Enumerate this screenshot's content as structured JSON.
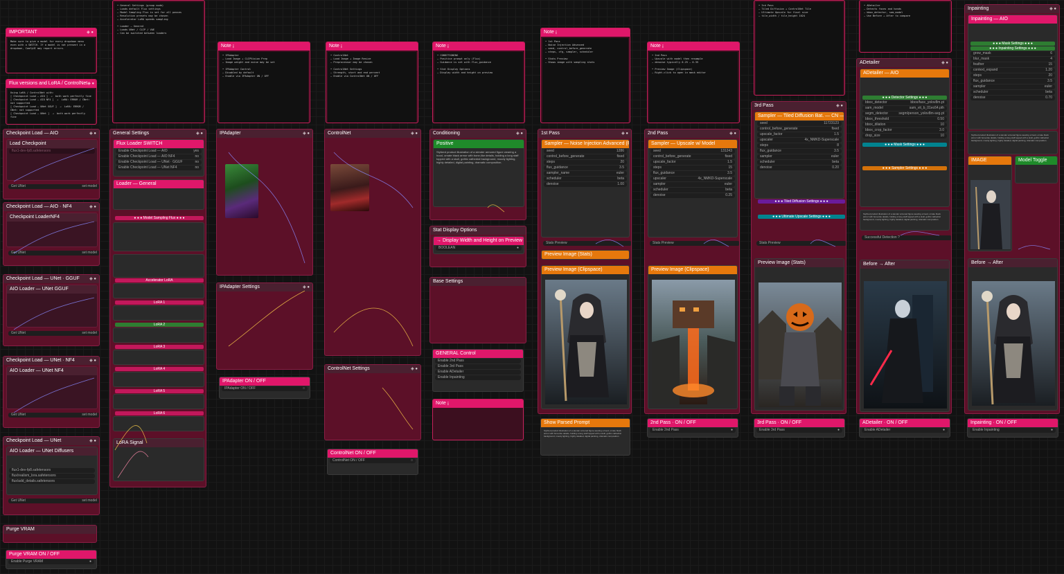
{
  "groups": {
    "ckpt_aio": "Checkpoint Load — AIO",
    "ckpt_aio_nf4": "Checkpoint Load — AIO · NF4",
    "ckpt_unet_gguf": "Checkpoint Load — UNet · GGUF",
    "ckpt_unet_nf4": "Checkpoint Load — UNet · NF4",
    "ckpt_unet": "Checkpoint Load — UNet",
    "purge_vram": "Purge VRAM",
    "general": "General Settings",
    "ipadapter": "IPAdapter",
    "ipadapter_settings": "IPAdapter Settings",
    "controlnet": "ControlNet",
    "controlnet_settings": "ControlNet Settings",
    "conditioning": "Conditioning",
    "stat_display": "Stat Display Options",
    "base_settings": "Base Settings",
    "first_pass": "1st Pass",
    "second_pass": "2nd Pass",
    "third_pass": "3rd Pass",
    "adetailer": "ADetailer",
    "inpainting": "Inpainting"
  },
  "nodes": {
    "important": "IMPORTANT",
    "flux_versions": "Flux versions and LoRA / ControlNet",
    "load_checkpoint": "Load Checkpoint",
    "checkpoint_loader_nf4": "Checkpoint LoaderNF4",
    "aio_loader_unet_gguf": "AIO Loader — UNet GGUF",
    "aio_loader_unet_nf4": "AIO Loader — UNet NF4",
    "aio_loader_unet_diffusers": "AIO Loader — UNet Diffusers",
    "flux_loader_switch": "Flux Loader SWITCH",
    "loader_general": "Loader — General",
    "lora_signal": "LoRA Signal",
    "ipadapter_onoff": "IPAdapter ON / OFF",
    "controlnet_onoff": "ControlNet ON / OFF",
    "positive": "Positive",
    "display_wh": "→ Display Width and Height on Preview ? ←",
    "general_control": "GENERAL Control",
    "sampler_1st": "Sampler — Noise Injection Advanced (Flux)",
    "sampler_2nd": "Sampler — Upscale w/ Model",
    "sampler_3rd": "Sampler — Tiled Diffusion Bat. — CN — Ultimate Upscale",
    "adetailer_aio": "ADetailer — AIO",
    "inpainting_aio": "Inpainting — AIO",
    "preview_stats": "Preview Image (Stats)",
    "preview_clip": "Preview Image (Clipspace)",
    "show_parsed_prompt": "Show Parsed Prompt",
    "pass2_onoff": "2nd Pass · ON / OFF",
    "pass3_onoff": "3rd Pass · ON / OFF",
    "adetailer_onoff": "ADetailer · ON / OFF",
    "inpainting_onoff": "Inpainting · ON / OFF",
    "purge_onoff": "Purge VRAM ON / OFF",
    "before_after": "Before → After",
    "successful_detection": "Successful Detection ?",
    "note": "Note ¡"
  },
  "labels": {
    "opt_connection": "OPT_CONNECTION",
    "model_sampling": "● ● ● Model Sampling Flux ● ● ●",
    "accelerator_lora": "Accelerator LoRA",
    "lora_1": "LoRA 1",
    "lora_2": "LoRA 2",
    "lora_3": "LoRA 3",
    "lora_4": "LoRA 4",
    "lora_5": "LoRA 5",
    "lora_6": "LoRA 6",
    "get_unet": "Get UNet",
    "set_model": "set model",
    "enable_2nd": "Enable 2nd Pass",
    "enable_3rd": "Enable 3rd Pass",
    "enable_adetailer": "Enable ADetailer",
    "enable_inpainting": "Enable Inpainting",
    "enable_purge": "Enable Purge VRAM",
    "boolean": "BOOLEAN",
    "image": "IMAGE",
    "stats_preview": "Stats Preview",
    "mask_settings": "● ● ● Mask Settings ● ● ●",
    "inpainting_settings": "● ● ● Inpainting Settings ● ● ●",
    "sampler_settings": "● ● ● Sampler Settings ● ● ●",
    "detector_settings": "● ● ● Detector Settings ● ● ●",
    "tiled_diffusion_settings": "● ● ● Tiled Diffusion Settings ● ● ●",
    "ultimate_upscale_settings": "● ● ● Ultimate Upscale Settings ● ● ●",
    "model_toggle": "Model Toggle",
    "loras_list": [
      "flux1-dev-fp8.safetensors",
      "flux/realism_lora.safetensors",
      "flux/add_details.safetensors"
    ]
  },
  "flux_versions_text": "Using LoRA / ControlNet with:\n[ Checkpoint Load — AIO ]  →  both work perfectly fine\n[ Checkpoint Load — AIO NF4 ]  →  LoRA: ERROR / CNet: not supported\n[ Checkpoint Load — UNet GGUF ]  →  LoRA: ERROR / CNet: not supported\n[ Checkpoint Load — UNet ]  →  both work perfectly fine",
  "important_text": "Make sure to give a model for every dropdown menu\neven with a SWITCH. If a model is not present in a\ndropdown, ComfyUI may report errors.",
  "prompt_text": "Stylized product illustration of a slender armored figure wearing a hood, ornate black armor with bone-like details, holding a long staff topped with a skull, gothic cathedral background, moody lighting, highly detailed, digital painting, dramatic composition.",
  "notes_text": [
    "• General Settings (group node)\n— Loads default Flux settings\n— Model Sampling Flux is set for all passes\n— Resolution presets may be chosen\n— Accelerator LoRA speeds sampling\n\n• Loader — General\n— Loads UNet / CLIP / VAE\n— Can be switched between loaders",
    "• IPAdapter\n— Load Image + CLIPVision Prep\n— Image weight and noise may be set\n\n• IPAdapter Control\n— Disabled by default\n— Enable via IPAdapter ON / OFF",
    "• ControlNet\n— Load Image + Image Resize\n— Preprocessor may be chosen\n\n• ControlNet Settings\n— Strength, start and end percent\n— Enable via ControlNet ON / OFF",
    "• CONDITIONING\n— Positive prompt only (Flux)\n— Guidance is set with flux_guidance\n\n• Stat Display Options\n— Display width and height on preview",
    "• 1st Pass\n— Noise Injection Advanced\n— seed, control_before_generate\n— steps, cfg, sampler, scheduler\n\n• Stats Preview\n— Shows image with sampling stats",
    "• 2nd Pass\n— Upscale with model then resample\n— denoise typically 0.25 – 0.35\n\n• Preview Image (Clipspace)\n— Right-click to open in mask editor",
    "• 3rd Pass\n— Tiled Diffusion + ControlNet Tile\n— Ultimate Upscale for final size\n— tile_width / tile_height 1024",
    "• ADetailer\n— Detects faces and hands\n— bbox_detector, sam_model\n— Use Before → After to compare",
    "• Inpainting\n— Load image into Clipspace\n— Paint mask, then enable\n— grow_mask and blur_mask"
  ],
  "widgets": {
    "general_switch": [
      "Enable Checkpoint Load — AIO",
      "Enable Checkpoint Load — AIO NF4",
      "Enable Checkpoint Load — UNet · GGUF",
      "Enable Checkpoint Load — UNet NF4",
      "Enable Checkpoint Load — UNet"
    ],
    "general_switch_values": [
      "yes",
      "no",
      "no",
      "no",
      "no"
    ],
    "sampler_1st_rows": [
      {
        "k": "seed",
        "v": "1286"
      },
      {
        "k": "control_before_generate",
        "v": "fixed"
      },
      {
        "k": "steps",
        "v": "20"
      },
      {
        "k": "flux_guidance",
        "v": "3.5"
      },
      {
        "k": "sampler_name",
        "v": "euler"
      },
      {
        "k": "scheduler",
        "v": "beta"
      },
      {
        "k": "denoise",
        "v": "1.00"
      }
    ],
    "sampler_2nd_rows": [
      {
        "k": "seed",
        "v": "131243"
      },
      {
        "k": "control_before_generate",
        "v": "fixed"
      },
      {
        "k": "upscale_factor",
        "v": "1.5"
      },
      {
        "k": "steps",
        "v": "15"
      },
      {
        "k": "flux_guidance",
        "v": "3.5"
      },
      {
        "k": "upscaler",
        "v": "4x_NMKD-Superscale"
      },
      {
        "k": "sampler",
        "v": "euler"
      },
      {
        "k": "scheduler",
        "v": "beta"
      },
      {
        "k": "denoise",
        "v": "0.25"
      }
    ],
    "sampler_3rd_rows": [
      {
        "k": "seed",
        "v": "11723123"
      },
      {
        "k": "control_before_generate",
        "v": "fixed"
      },
      {
        "k": "upscale_factor",
        "v": "1.5"
      },
      {
        "k": "upscaler",
        "v": "4x_NMKD-Superscale"
      },
      {
        "k": "steps",
        "v": "8"
      },
      {
        "k": "flux_guidance",
        "v": "3.5"
      },
      {
        "k": "sampler",
        "v": "euler"
      },
      {
        "k": "scheduler",
        "v": "beta"
      },
      {
        "k": "denoise",
        "v": "0.20"
      }
    ],
    "adetailer_rows": [
      {
        "k": "bbox_detector",
        "v": "bbox/face_yolov8m.pt"
      },
      {
        "k": "sam_model",
        "v": "sam_vit_b_01ec64.pth"
      },
      {
        "k": "segm_detector",
        "v": "segm/person_yolov8m-seg.pt"
      },
      {
        "k": "bbox_threshold",
        "v": "0.50"
      },
      {
        "k": "bbox_dilation",
        "v": "10"
      },
      {
        "k": "bbox_crop_factor",
        "v": "3.0"
      },
      {
        "k": "drop_size",
        "v": "10"
      }
    ],
    "inpainting_rows": [
      {
        "k": "grow_mask",
        "v": "6"
      },
      {
        "k": "blur_mask",
        "v": "4"
      },
      {
        "k": "feather",
        "v": "15"
      },
      {
        "k": "context_expand",
        "v": "1.20"
      },
      {
        "k": "steps",
        "v": "20"
      },
      {
        "k": "flux_guidance",
        "v": "3.5"
      },
      {
        "k": "sampler",
        "v": "euler"
      },
      {
        "k": "scheduler",
        "v": "beta"
      },
      {
        "k": "denoise",
        "v": "0.70"
      }
    ]
  },
  "colors": {
    "accent": "#e0176a",
    "node_bg": "#2a2a2a",
    "group_bg": "#5c1028",
    "orange": "#e6780c",
    "green": "#1f8a2a"
  }
}
